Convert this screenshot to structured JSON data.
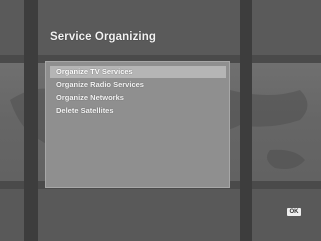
{
  "screen": {
    "title": "Service Organizing"
  },
  "menu": {
    "items": [
      {
        "label": "Organize TV Services",
        "selected": true
      },
      {
        "label": "Organize Radio Services",
        "selected": false
      },
      {
        "label": "Organize Networks",
        "selected": false
      },
      {
        "label": "Delete Satellites",
        "selected": false
      }
    ]
  },
  "footer": {
    "ok_label": "OK"
  },
  "colors": {
    "background": "#6d6d6d",
    "panel": "#8f8f8f",
    "highlight": "#b5b5b5",
    "text": "#f3f3f3"
  },
  "icons": {
    "ok_button": "ok-key-icon",
    "background_map": "world-map-icon"
  }
}
